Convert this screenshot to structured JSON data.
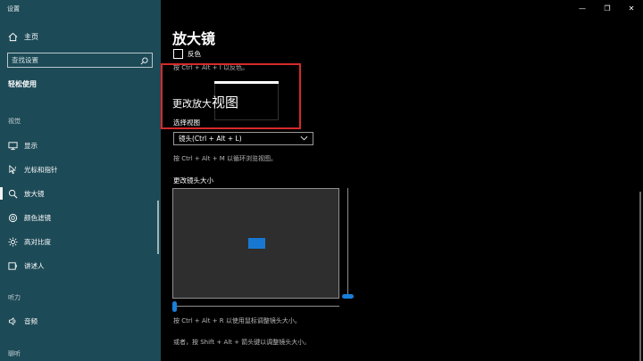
{
  "window": {
    "title": "设置",
    "minimize": "—",
    "maximize": "❐",
    "close": "✕"
  },
  "sidebar": {
    "home_label": "主页",
    "search_placeholder": "查找设置",
    "section_title": "轻松使用",
    "group_vision": "视觉",
    "items": [
      {
        "label": "显示",
        "icon": "display-icon"
      },
      {
        "label": "光标和指针",
        "icon": "cursor-icon"
      },
      {
        "label": "放大镜",
        "icon": "magnifier-icon",
        "active": true
      },
      {
        "label": "颜色滤镜",
        "icon": "color-filter-icon"
      },
      {
        "label": "高对比度",
        "icon": "brightness-icon"
      },
      {
        "label": "讲述人",
        "icon": "narrator-icon"
      }
    ],
    "group_hearing": "听力",
    "hearing_items": [
      {
        "label": "音频",
        "icon": "speaker-icon"
      }
    ],
    "group_next": "聊听"
  },
  "main": {
    "title": "放大镜",
    "invert_label": "反色",
    "invert_checked": false,
    "invert_hint": "按 Ctrl + Alt + I 以反色。",
    "change_view_heading": "更改放大",
    "change_view_heading_big": "视图",
    "select_view_label": "选择视图",
    "view_select_value": "镜头(Ctrl + Alt + L)",
    "view_hint": "按 Ctrl + Alt + M 以循环浏览视图。",
    "lens_size_label": "更改镜头大小",
    "lens_hint_1": "按 Ctrl + Alt + R 以使用鼠标调整镜头大小。",
    "lens_hint_2": "或者，按 Shift + Alt + 箭头键以调整镜头大小。"
  },
  "colors": {
    "sidebar_bg": "#1d4a57",
    "accent": "#1a7fd8",
    "highlight_border": "#d62a2a"
  }
}
